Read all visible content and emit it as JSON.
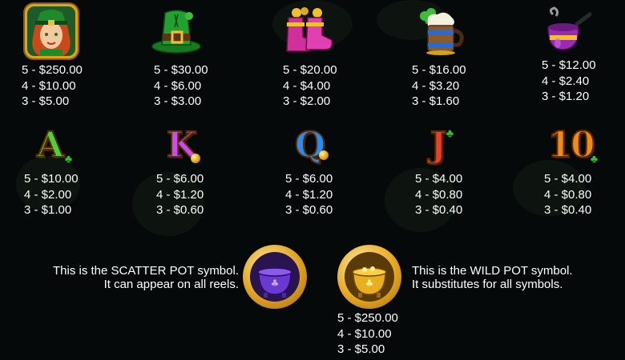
{
  "high_symbols": [
    {
      "name": "leprechaun-girl",
      "pays": [
        "5 - $250.00",
        "4 - $10.00",
        "3 - $5.00"
      ]
    },
    {
      "name": "green-hat",
      "pays": [
        "5 - $30.00",
        "4 - $6.00",
        "3 - $3.00"
      ]
    },
    {
      "name": "pink-boots",
      "pays": [
        "5 - $20.00",
        "4 - $4.00",
        "3 - $2.00"
      ]
    },
    {
      "name": "beer-mug",
      "pays": [
        "5 - $16.00",
        "4 - $3.20",
        "3 - $1.60"
      ]
    },
    {
      "name": "pipe",
      "pays": [
        "5 - $12.00",
        "4 - $2.40",
        "3 - $1.20"
      ]
    }
  ],
  "low_symbols": [
    {
      "letter": "A",
      "color": "#4cd13a",
      "pays": [
        "5 - $10.00",
        "4 - $2.00",
        "3 - $1.00"
      ]
    },
    {
      "letter": "K",
      "color": "#c84cf0",
      "pays": [
        "5 - $6.00",
        "4 - $1.20",
        "3 - $0.60"
      ]
    },
    {
      "letter": "Q",
      "color": "#2a8cf0",
      "pays": [
        "5 - $6.00",
        "4 - $1.20",
        "3 - $0.60"
      ]
    },
    {
      "letter": "J",
      "color": "#e8402a",
      "pays": [
        "5 - $4.00",
        "4 - $0.80",
        "3 - $0.40"
      ]
    },
    {
      "letter": "10",
      "color": "#f08a1a",
      "pays": [
        "5 - $4.00",
        "4 - $0.80",
        "3 - $0.40"
      ]
    }
  ],
  "scatter": {
    "line1": "This is the SCATTER POT symbol.",
    "line2": "It can appear on all reels."
  },
  "wild": {
    "line1": "This is the WILD POT symbol.",
    "line2": "It substitutes for all symbols.",
    "pays": [
      "5 - $250.00",
      "4 - $10.00",
      "3 - $5.00"
    ]
  }
}
